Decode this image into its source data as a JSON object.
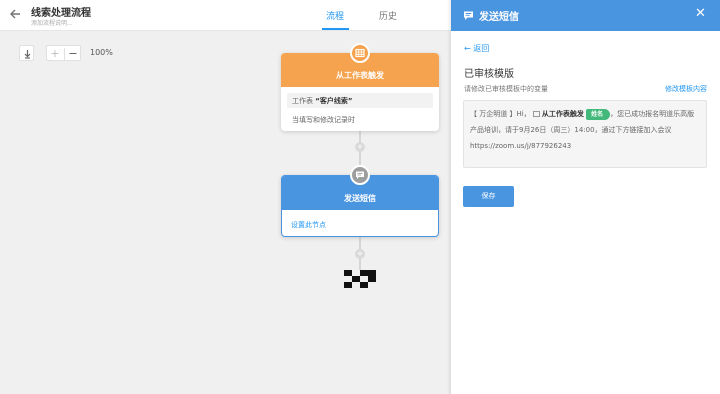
{
  "header": {
    "title": "线索处理流程",
    "subtitle": "添加流程说明...",
    "tabs": [
      {
        "label": "流程",
        "active": true
      },
      {
        "label": "历史",
        "active": false
      }
    ]
  },
  "canvas": {
    "zoom_in": "+",
    "zoom_out": "−",
    "zoom_level": "100%",
    "trigger_node": {
      "title": "从工作表触发",
      "sheet_prefix": "工作表",
      "sheet_name": "“客户线索”",
      "condition": "当填写和修改记录时",
      "color": "#f5a34e"
    },
    "sms_node": {
      "title": "发送短信",
      "setup_link": "设置此节点",
      "color": "#4a95e0"
    },
    "add_step_symbol": "+"
  },
  "panel": {
    "title": "发送短信",
    "close_symbol": "✕",
    "back_label": "← 返回",
    "section_title": "已审核模版",
    "hint": "请修改已审核模板中的变量",
    "edit_link": "修改模板内容",
    "template": {
      "part1": "【 万企明道 】Hi，",
      "field_name": "从工作表触发",
      "variable": "姓名",
      "part2": "，您已成功报名明道乐高版产品培训，请于9月26日（周三）14:00，通过下方链接加入会议",
      "link": "https://zoom.us/j/877926243"
    },
    "save_label": "保存",
    "accent": "#4a95e0",
    "variable_color": "#42b87a"
  }
}
